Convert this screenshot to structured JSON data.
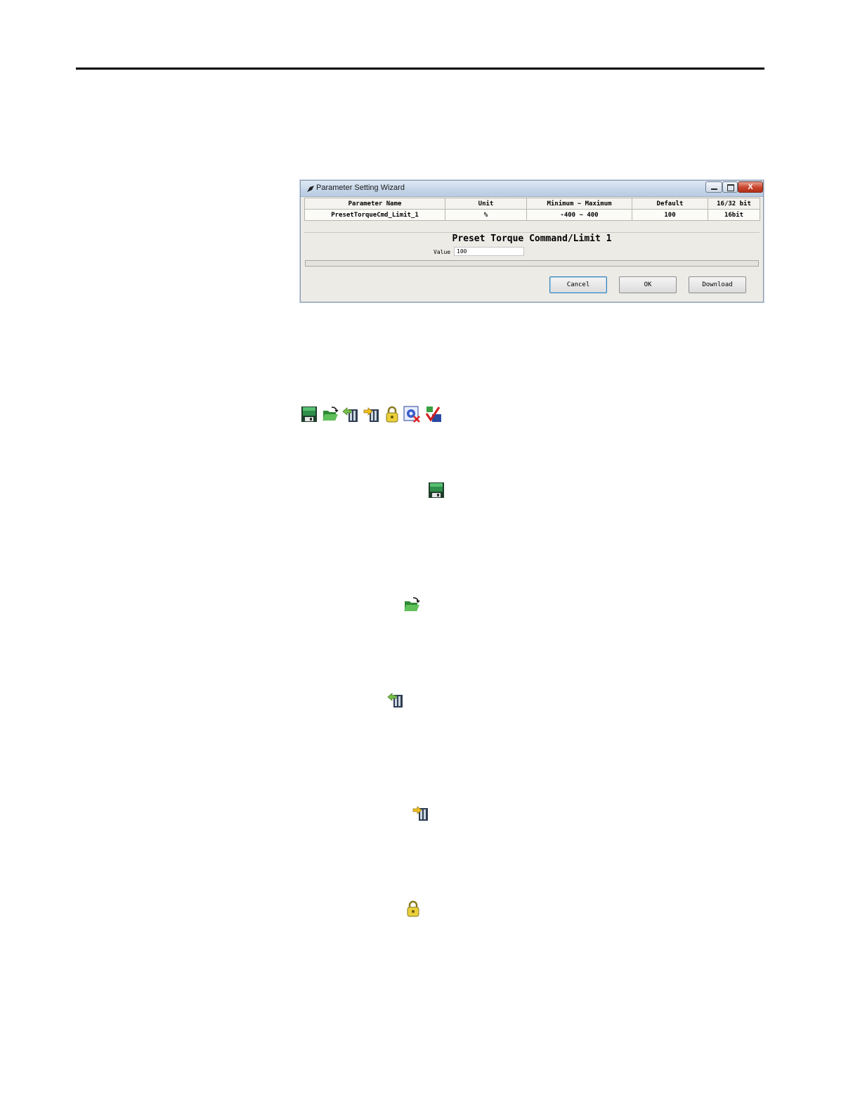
{
  "dialog": {
    "title": "Parameter Setting Wizard",
    "window_controls": {
      "close_glyph": "X"
    },
    "table": {
      "headers": [
        "Parameter Name",
        "Unit",
        "Minimum ~ Maximum",
        "Default",
        "16/32 bit"
      ],
      "row": [
        "PresetTorqueCmd_Limit_1",
        "%",
        "-400 ~ 400",
        "100",
        "16bit"
      ]
    },
    "heading": "Preset Torque Command/Limit 1",
    "value_label": "Value",
    "value": "100",
    "buttons": {
      "cancel": "Cancel",
      "ok": "OK",
      "download": "Download"
    }
  },
  "toolbar_icons": [
    "save-icon",
    "open-folder-icon",
    "upload-icon",
    "download-icon",
    "lock-icon",
    "settings-reset-icon",
    "verify-icon"
  ],
  "colors": {
    "titlebar": "#c5d5e8",
    "close_button": "#c8442c",
    "dialog_bg": "#ecebe6"
  }
}
